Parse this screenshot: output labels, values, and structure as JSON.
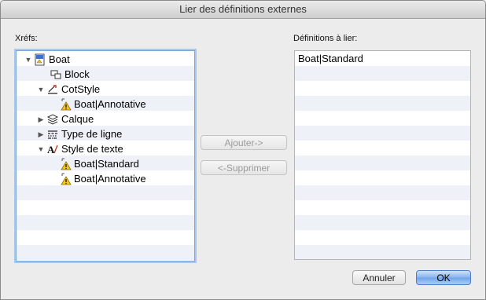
{
  "window": {
    "title": "Lier des définitions externes"
  },
  "xrefs": {
    "label": "Xréfs:",
    "tree": [
      {
        "label": "Boat",
        "icon": "drawing-file-icon",
        "expanded": true,
        "depth": 0
      },
      {
        "label": "Block",
        "icon": "block-icon",
        "depth": 1
      },
      {
        "label": "CotStyle",
        "icon": "dimension-style-icon",
        "expanded": true,
        "depth": 1
      },
      {
        "label": "Boat|Annotative",
        "icon": "warning-icon",
        "depth": 2
      },
      {
        "label": "Calque",
        "icon": "layer-icon",
        "expanded": false,
        "depth": 1
      },
      {
        "label": "Type de ligne",
        "icon": "linetype-icon",
        "expanded": false,
        "depth": 1
      },
      {
        "label": "Style de texte",
        "icon": "text-style-icon",
        "expanded": true,
        "depth": 1
      },
      {
        "label": "Boat|Standard",
        "icon": "warning-icon",
        "depth": 2
      },
      {
        "label": "Boat|Annotative",
        "icon": "warning-icon",
        "depth": 2
      }
    ]
  },
  "definitions": {
    "label": "Définitions à lier:",
    "items": [
      "Boat|Standard"
    ]
  },
  "buttons": {
    "add": "Ajouter->",
    "remove": "<-Supprimer",
    "cancel": "Annuler",
    "ok": "OK"
  },
  "colors": {
    "focus_ring": "#7aa6d6",
    "row_stripe": "#eef1f7",
    "default_button": "#6fa4e8"
  }
}
